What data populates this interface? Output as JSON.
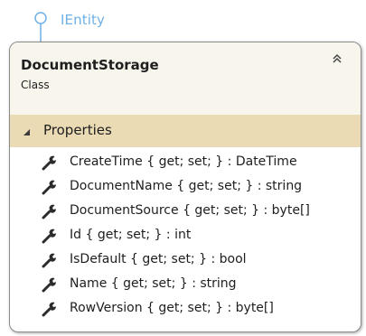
{
  "interface": {
    "name": "IEntity"
  },
  "class": {
    "name": "DocumentStorage",
    "stereotype": "Class"
  },
  "sections": [
    {
      "title": "Properties",
      "members": [
        {
          "icon": "wrench-icon",
          "text": "CreateTime { get; set; } : DateTime"
        },
        {
          "icon": "wrench-icon",
          "text": "DocumentName { get; set; } : string"
        },
        {
          "icon": "wrench-icon",
          "text": "DocumentSource { get; set; } : byte[]"
        },
        {
          "icon": "wrench-icon",
          "text": "Id { get; set; } : int"
        },
        {
          "icon": "wrench-icon",
          "text": "IsDefault { get; set; } : bool"
        },
        {
          "icon": "wrench-icon",
          "text": "Name { get; set; } : string"
        },
        {
          "icon": "wrench-icon",
          "text": "RowVersion { get; set; } : byte[]"
        }
      ]
    }
  ],
  "colors": {
    "interface_accent": "#6fb0e6",
    "header_background": "#f8f5ec",
    "section_background": "#ebdbb5",
    "border": "#8c8c8c"
  }
}
